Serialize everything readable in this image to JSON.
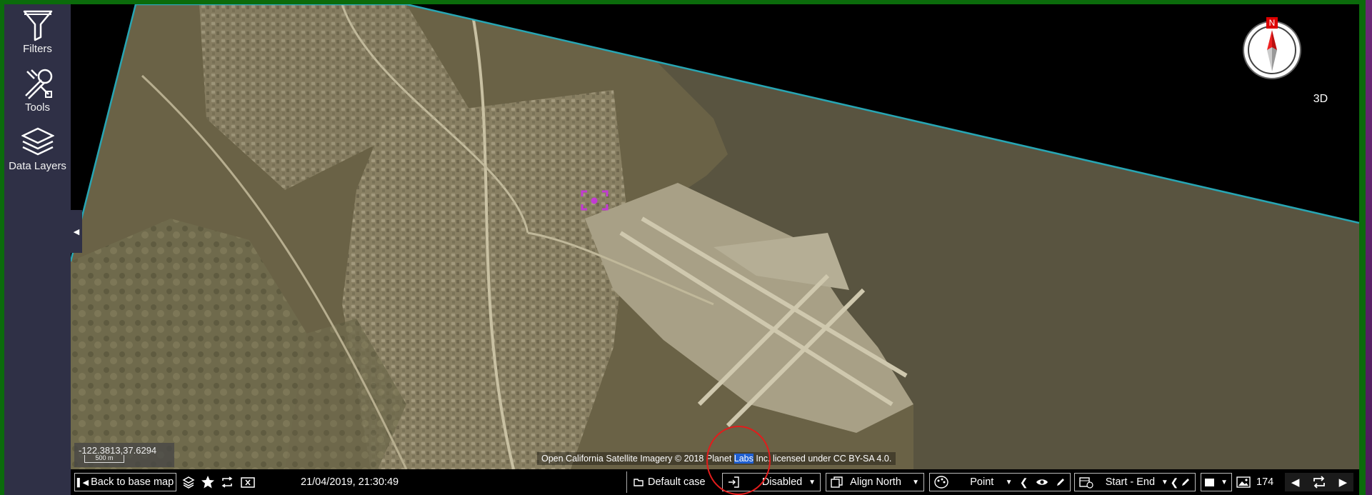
{
  "sidebar": {
    "items": [
      {
        "label": "Filters",
        "icon": "filter-icon"
      },
      {
        "label": "Tools",
        "icon": "tools-icon"
      },
      {
        "label": "Data Layers",
        "icon": "layers-icon"
      }
    ]
  },
  "map": {
    "compass_letter": "N",
    "view_mode": "3D",
    "coordinates": "-122.3813,37.6294",
    "scale": "500 m",
    "attribution_prefix": "Open California Satellite Imagery © 2018 Planet ",
    "attribution_highlight": "Labs",
    "attribution_suffix": " Inc. licensed under CC BY-SA 4.0.",
    "marker_color": "#c23ad3",
    "boundary_color": "#27a6b4"
  },
  "toolbar": {
    "back_label": "Back to base map",
    "datetime": "21/04/2019, 21:30:49",
    "case_label": "Default case",
    "mode_value": "Disabled",
    "align_value": "Align North",
    "point_value": "Point",
    "range_value": "Start - End",
    "image_count": "174"
  },
  "colors": {
    "sidebar_bg": "#2f3046",
    "frame_green": "#0b6b0b",
    "annotation_red": "#e21c1c"
  }
}
